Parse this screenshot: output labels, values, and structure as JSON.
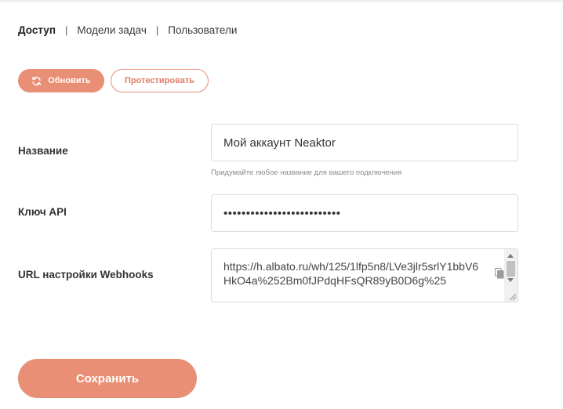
{
  "tabs": [
    {
      "label": "Доступ",
      "active": true
    },
    {
      "label": "Модели задач",
      "active": false
    },
    {
      "label": "Пользователи",
      "active": false
    }
  ],
  "tab_separator": "|",
  "actions": {
    "refresh_label": "Обновить",
    "refresh_icon": "refresh-icon",
    "test_label": "Протестировать"
  },
  "form": {
    "name": {
      "label": "Название",
      "value": "Мой аккаунт Neaktor",
      "hint": "Придумайте любое название для вашего подключения"
    },
    "api_key": {
      "label": "Ключ API",
      "value": "••••••••••••••••••••••••••"
    },
    "webhook": {
      "label": "URL настройки Webhooks",
      "value": "https://h.albato.ru/wh/125/1lfp5n8/LVe3jlr5srlY1bbV6HkO4a%252Bm0fJPdqHFsQR89yB0D6g%25",
      "copy_icon": "copy-icon"
    }
  },
  "save_label": "Сохранить",
  "colors": {
    "accent": "#e88f75",
    "accent_text": "#e07d62"
  }
}
